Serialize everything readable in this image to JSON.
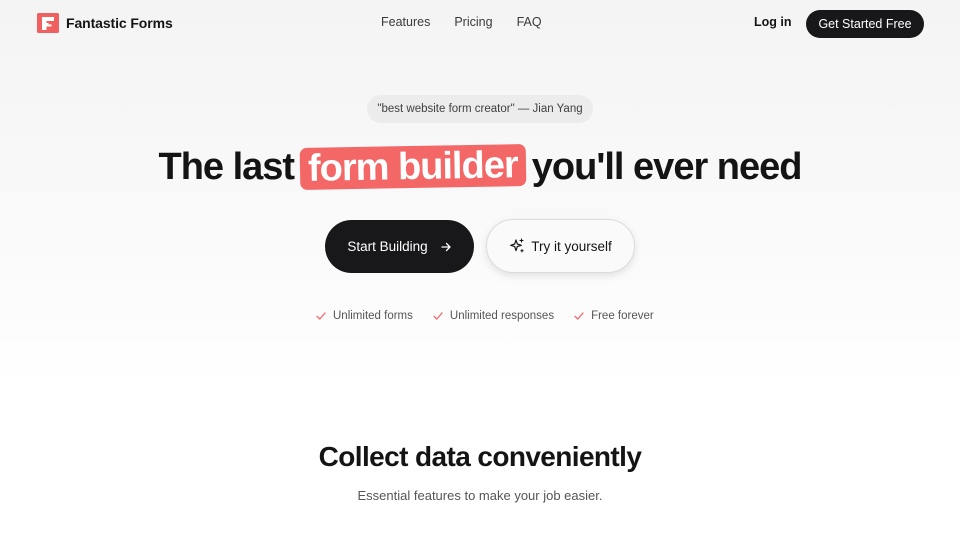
{
  "header": {
    "brand": "Fantastic Forms",
    "nav": [
      "Features",
      "Pricing",
      "FAQ"
    ],
    "login": "Log in",
    "cta": "Get Started Free"
  },
  "hero": {
    "quote": "\"best website form creator\" — Jian Yang",
    "headline_before": "The last",
    "headline_highlight": "form builder",
    "headline_after": "you'll ever need",
    "primary_button": "Start Building",
    "secondary_button": "Try it yourself",
    "perks": [
      "Unlimited forms",
      "Unlimited responses",
      "Free forever"
    ]
  },
  "features": {
    "title": "Collect data conveniently",
    "subtitle": "Essential features to make your job easier."
  },
  "colors": {
    "accent": "#f46767",
    "dark": "#18181a"
  },
  "icons": {
    "logo": "fantastic-forms-logo",
    "arrow": "arrow-right-icon",
    "sparkle": "sparkle-icon",
    "check": "check-icon"
  }
}
